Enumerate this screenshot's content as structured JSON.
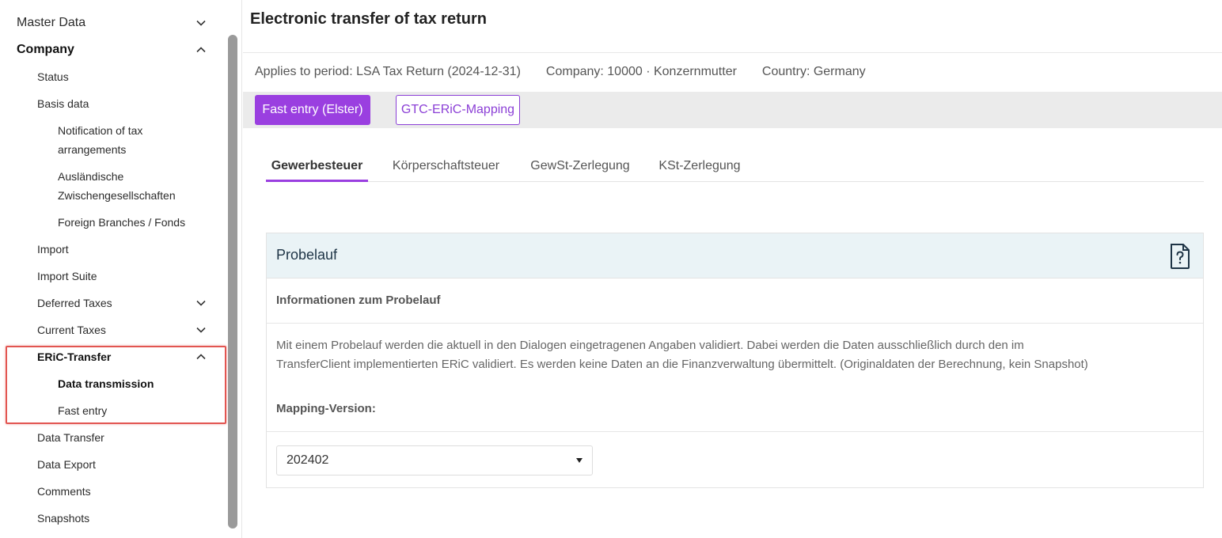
{
  "sidebar": {
    "master_data": "Master Data",
    "company": "Company",
    "status": "Status",
    "basis_data": "Basis data",
    "notification_line1": "Notification of tax",
    "notification_line2": "arrangements",
    "auslaendische_line1": "Ausländische",
    "auslaendische_line2": "Zwischengesellschaften",
    "foreign_branches": "Foreign Branches / Fonds",
    "import": "Import",
    "import_suite": "Import Suite",
    "deferred_taxes": "Deferred Taxes",
    "current_taxes": "Current Taxes",
    "eric_transfer": "ERiC-Transfer",
    "data_transmission": "Data transmission",
    "fast_entry": "Fast entry",
    "data_transfer": "Data Transfer",
    "data_export": "Data Export",
    "comments": "Comments",
    "snapshots": "Snapshots"
  },
  "header": {
    "title": "Electronic transfer of tax return",
    "period": "Applies to period: LSA Tax Return (2024-12-31)",
    "company": "Company: 10000 · Konzernmutter",
    "country": "Country: Germany"
  },
  "actions": {
    "fast_entry": "Fast entry (Elster)",
    "mapping": "GTC-ERiC-Mapping"
  },
  "tabs": {
    "gewerbesteuer": "Gewerbesteuer",
    "koerperschaftsteuer": "Körperschaftsteuer",
    "gewst_zerlegung": "GewSt-Zerlegung",
    "kst_zerlegung": "KSt-Zerlegung"
  },
  "panel": {
    "title": "Probelauf",
    "info_heading": "Informationen zum Probelauf",
    "description_line1": "Mit einem Probelauf werden die aktuell in den Dialogen eingetragenen Angaben validiert. Dabei werden die Daten ausschließlich durch den im",
    "description_line2": "TransferClient implementierten ERiC validiert. Es werden keine Daten an die Finanzverwaltung übermittelt. (Originaldaten der Berechnung, kein Snapshot)",
    "mapping_label": "Mapping-Version:",
    "mapping_value": "202402"
  },
  "colors": {
    "accent": "#9a3fe0",
    "highlight": "#e25551",
    "panel_head": "#eaf3f6"
  },
  "icons": {
    "expand": "chevron-down-icon",
    "collapse": "chevron-up-icon",
    "help": "help-document-icon"
  }
}
